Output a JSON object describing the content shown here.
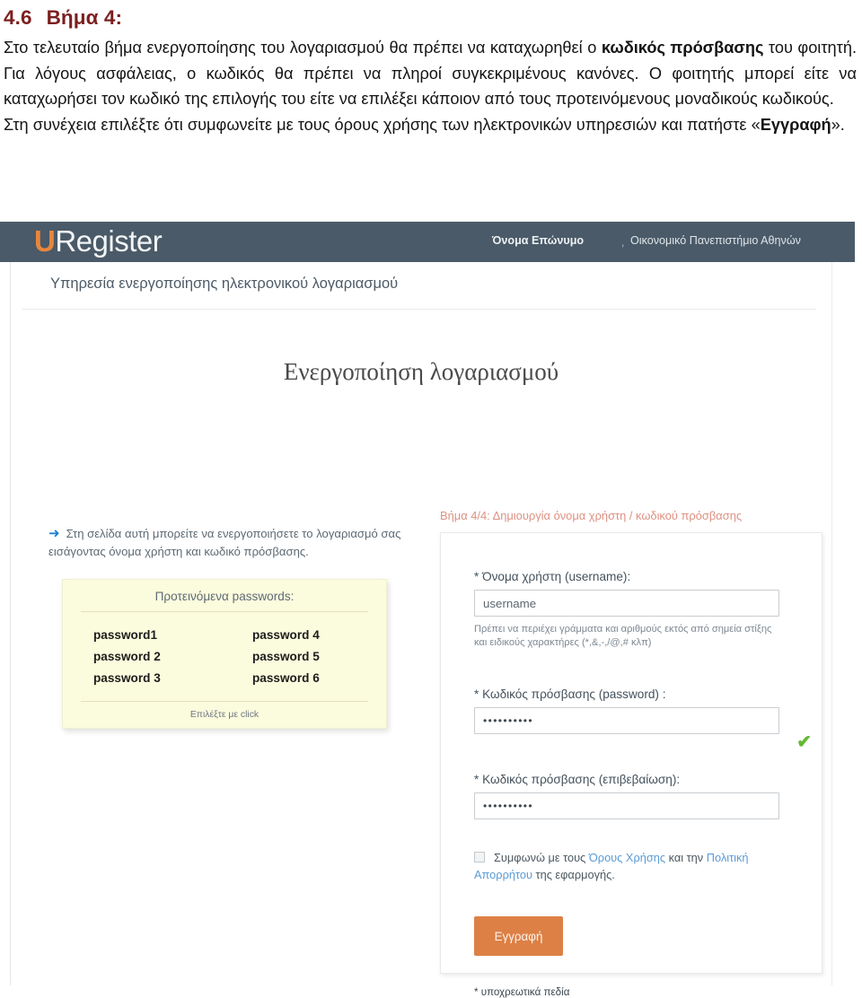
{
  "document": {
    "heading_number": "4.6",
    "heading_text": "Βήμα 4:",
    "paragraph_1_a": "Στο τελευταίο βήμα ενεργοποίησης του λογαριασμού θα πρέπει να καταχωρηθεί ο ",
    "paragraph_1_b": "κωδικός πρόσβασης",
    "paragraph_1_c": " του φοιτητή. Για λόγους ασφάλειας, ο κωδικός θα πρέπει να πληροί συγκεκριμένους κανόνες. Ο φοιτητής μπορεί είτε να καταχωρήσει τον κωδικό της επιλογής του είτε να επιλέξει κάποιον από τους προτεινόμενους μοναδικούς κωδικούς.",
    "paragraph_2_a": "Στη συνέχεια επιλέξτε ότι συμφωνείτε με τους όρους χρήσης των ηλεκτρονικών υπηρεσιών και πατήστε «",
    "paragraph_2_b": "Εγγραφή",
    "paragraph_2_c": "»."
  },
  "app": {
    "topbar": {
      "logo_first_letter": "U",
      "logo_rest": "Register",
      "user_name": "Όνομα Επώνυμο",
      "separator": ",",
      "organization": "Οικονομικό Πανεπιστήμιο Αθηνών",
      "background_color": "#4a5a68",
      "logo_accent_color": "#e8863c"
    },
    "service_title": "Υπηρεσία ενεργοποίησης ηλεκτρονικού λογαριασμού",
    "page_title": "Ενεργοποίηση λογαριασμού",
    "info": {
      "arrow_glyph": "➜",
      "text": "Στη σελίδα αυτή μπορείτε να ενεργοποιήσετε το λογαριασμό σας εισάγοντας όνομα χρήστη και κωδικό πρόσβασης."
    },
    "suggested_passwords": {
      "title": "Προτεινόμενα passwords:",
      "column_left": [
        "password1",
        "password 2",
        "password 3"
      ],
      "column_right": [
        "password 4",
        "password 5",
        "password 6"
      ],
      "footer": "Επιλέξτε με click",
      "background_color": "#fbfbdd"
    },
    "form": {
      "step_label": "Βήμα 4/4: Δημιουργία όνομα χρήστη / κωδικού πρόσβασης",
      "step_label_color": "#dd9182",
      "username": {
        "label": "* Όνομα χρήστη (username):",
        "value": "username",
        "hint": "Πρέπει να περιέχει γράμματα και αριθμούς εκτός από σημεία στίξης και ειδικούς χαρακτήρες (*,&,-,/@,# κλπ)"
      },
      "password": {
        "label": "* Κωδικός πρόσβασης (password) :",
        "value": "••••••••••",
        "valid_glyph": "✔",
        "valid_color": "#64b832"
      },
      "password_confirm": {
        "label": "* Κωδικός πρόσβασης (επιβεβαίωση):",
        "value": "••••••••••"
      },
      "terms": {
        "text_before": "Συμφωνώ με τους ",
        "link_1": "Όρους Χρήσης",
        "text_middle": " και την ",
        "link_2": "Πολιτική Απορρήτου",
        "text_after": " της εφαρμογής.",
        "checked": false
      },
      "submit_label": "Εγγραφή",
      "submit_color": "#dd8046",
      "required_note": "* υποχρεωτικά πεδία"
    }
  }
}
